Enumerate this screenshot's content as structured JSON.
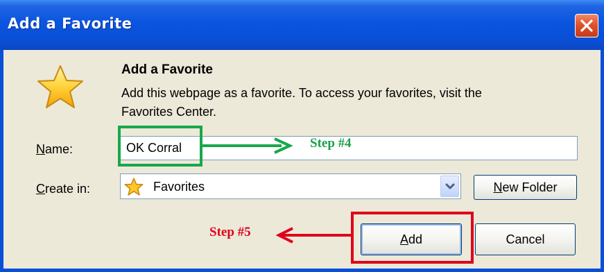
{
  "window": {
    "title": "Add a Favorite"
  },
  "header": {
    "heading": "Add a Favorite",
    "description_line1": "Add this webpage as a favorite. To access your favorites, visit the",
    "description_line2": "Favorites Center."
  },
  "form": {
    "name_label_accel": "N",
    "name_label_rest": "ame:",
    "name_value": "OK Corral",
    "create_in_label_accel": "C",
    "create_in_label_rest": "reate in:",
    "create_in_value": "Favorites"
  },
  "buttons": {
    "new_folder_accel": "N",
    "new_folder_rest": "ew Folder",
    "add_accel": "A",
    "add_rest": "dd",
    "cancel": "Cancel"
  },
  "annotations": {
    "step4": "Step #4",
    "step5": "Step #5",
    "step4_color": "#18a84a",
    "step5_color": "#e0001b"
  },
  "icons": {
    "close": "close-icon",
    "favorite_star": "star-icon",
    "dropdown": "chevron-down-icon"
  }
}
